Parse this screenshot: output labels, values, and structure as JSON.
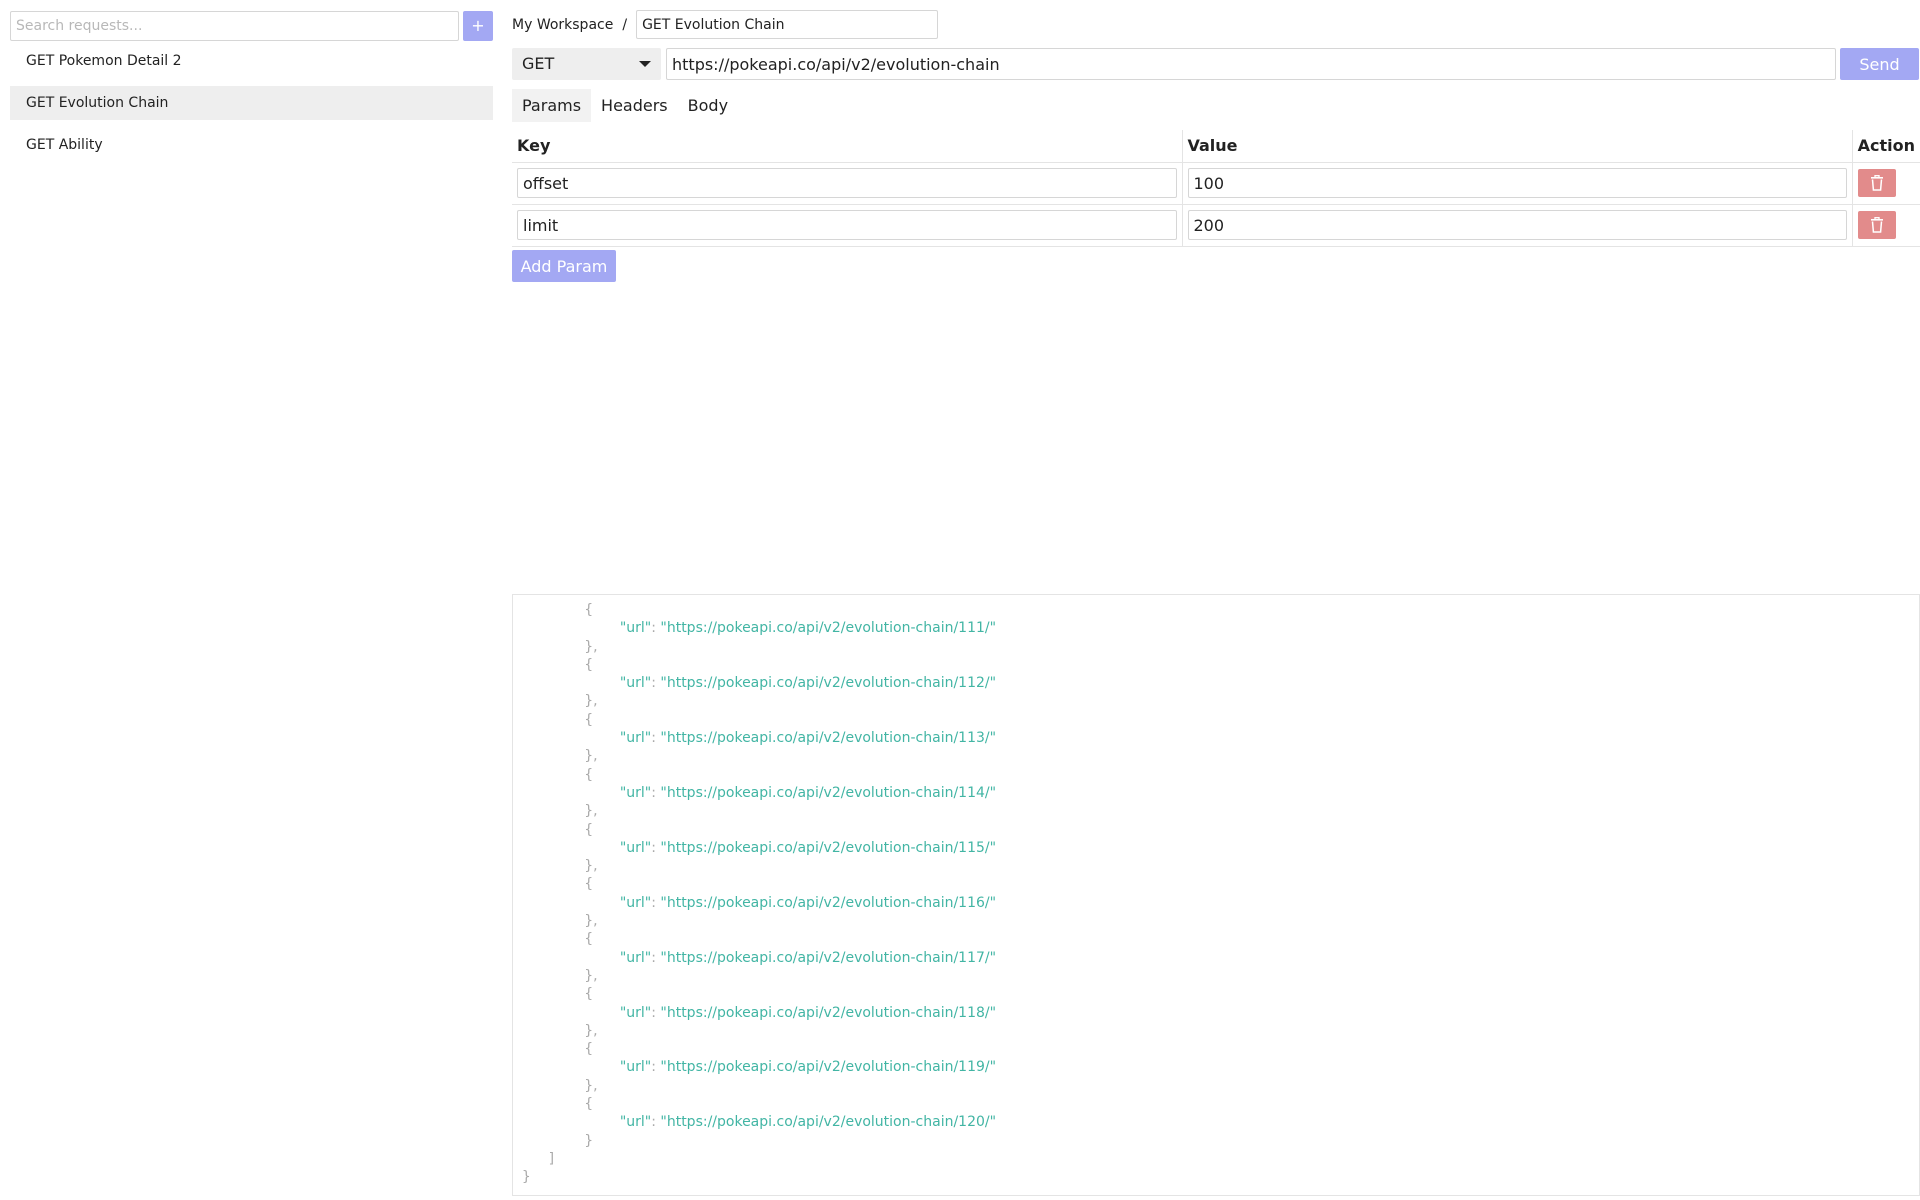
{
  "sidebar": {
    "search": {
      "placeholder": "Search requests...",
      "value": ""
    },
    "add_label": "+",
    "items": [
      {
        "label": "GET Pokemon Detail 2",
        "active": false
      },
      {
        "label": "GET Evolution Chain",
        "active": true
      },
      {
        "label": "GET Ability",
        "active": false
      }
    ]
  },
  "header": {
    "workspace": "My Workspace",
    "separator": "/",
    "request_name": "GET Evolution Chain"
  },
  "request": {
    "method": "GET",
    "url": "https://pokeapi.co/api/v2/evolution-chain",
    "send_label": "Send"
  },
  "tabs": [
    {
      "label": "Params",
      "active": true
    },
    {
      "label": "Headers",
      "active": false
    },
    {
      "label": "Body",
      "active": false
    }
  ],
  "params": {
    "columns": {
      "key": "Key",
      "value": "Value",
      "action": "Action"
    },
    "rows": [
      {
        "key": "offset",
        "value": "100"
      },
      {
        "key": "limit",
        "value": "200"
      }
    ],
    "add_label": "Add Param"
  },
  "response": {
    "url_key": "url",
    "urls": [
      "https://pokeapi.co/api/v2/evolution-chain/111/",
      "https://pokeapi.co/api/v2/evolution-chain/112/",
      "https://pokeapi.co/api/v2/evolution-chain/113/",
      "https://pokeapi.co/api/v2/evolution-chain/114/",
      "https://pokeapi.co/api/v2/evolution-chain/115/",
      "https://pokeapi.co/api/v2/evolution-chain/116/",
      "https://pokeapi.co/api/v2/evolution-chain/117/",
      "https://pokeapi.co/api/v2/evolution-chain/118/",
      "https://pokeapi.co/api/v2/evolution-chain/119/",
      "https://pokeapi.co/api/v2/evolution-chain/120/"
    ]
  },
  "colors": {
    "accent": "#a3a8f3",
    "danger": "#e28b8b",
    "json_string": "#42b5a4",
    "json_punctuation": "#aaaaaa"
  },
  "icons": {
    "delete": "trash-icon",
    "method_dropdown": "caret-down-icon"
  }
}
